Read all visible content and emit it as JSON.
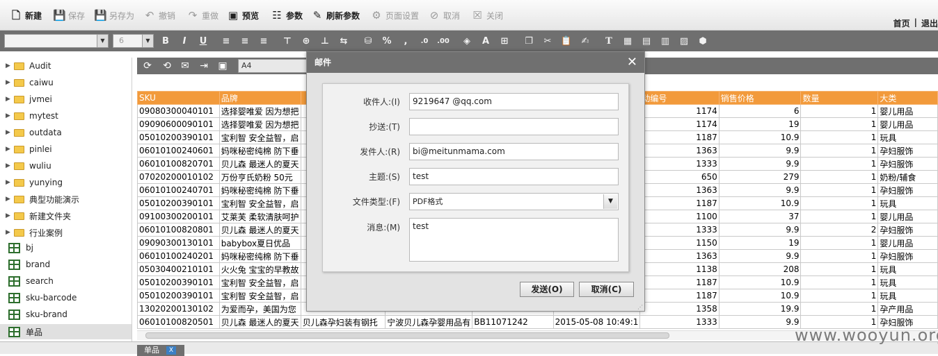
{
  "toolbar": {
    "new": "新建",
    "save": "保存",
    "save_as": "另存为",
    "undo": "撤销",
    "redo": "重做",
    "preview": "预览",
    "params": "参数",
    "refresh_params": "刷新参数",
    "page_setup": "页面设置",
    "cancel": "取消",
    "close": "关闭"
  },
  "top_nav": {
    "home": "首页",
    "logout": "退出"
  },
  "format_bar": {
    "font_size": "6"
  },
  "report_toolbar": {
    "zoom": "A4"
  },
  "sidebar": {
    "folders": [
      "Audit",
      "caiwu",
      "jvmei",
      "mytest",
      "outdata",
      "pinlei",
      "wuliu",
      "yunying",
      "典型功能演示",
      "新建文件夹",
      "行业案例"
    ],
    "reports": [
      "bj",
      "brand",
      "search",
      "sku-barcode",
      "sku-brand",
      "单品"
    ]
  },
  "table": {
    "headers": [
      "SKU",
      "品牌",
      "",
      "",
      "",
      "",
      "动编号",
      "销售价格",
      "数量",
      "大类"
    ],
    "rows": [
      [
        "09080300040101",
        "选择婴唯爱 因为想把",
        "",
        "",
        "",
        "",
        "1174",
        "6",
        "1",
        "婴儿用品"
      ],
      [
        "09090600090101",
        "选择婴唯爱 因为想把",
        "",
        "",
        "",
        "",
        "1174",
        "19",
        "1",
        "婴儿用品"
      ],
      [
        "05010200390101",
        "宝利智 安全益智，启",
        "",
        "",
        "",
        "",
        "1187",
        "10.9",
        "1",
        "玩具"
      ],
      [
        "06010100240601",
        "妈咪秘密纯棉 防下垂",
        "",
        "",
        "",
        "",
        "1363",
        "9.9",
        "1",
        "孕妇服饰"
      ],
      [
        "06010100820701",
        "贝儿森 最迷人的夏天",
        "",
        "",
        "",
        "",
        "1333",
        "9.9",
        "1",
        "孕妇服饰"
      ],
      [
        "07020200010102",
        "万份亨氏奶粉 50元",
        "",
        "",
        "",
        "",
        "650",
        "279",
        "1",
        "奶粉/辅食"
      ],
      [
        "06010100240701",
        "妈咪秘密纯棉 防下垂",
        "",
        "",
        "",
        "",
        "1363",
        "9.9",
        "1",
        "孕妇服饰"
      ],
      [
        "05010200390101",
        "宝利智 安全益智，启",
        "",
        "",
        "",
        "",
        "1187",
        "10.9",
        "1",
        "玩具"
      ],
      [
        "09100300200101",
        "艾莱芙 柔软清肤呵护",
        "",
        "",
        "",
        "",
        "1100",
        "37",
        "1",
        "婴儿用品"
      ],
      [
        "06010100820801",
        "贝儿森 最迷人的夏天",
        "",
        "",
        "",
        "",
        "1333",
        "9.9",
        "2",
        "孕妇服饰"
      ],
      [
        "09090300130101",
        "babybox夏日优品",
        "",
        "",
        "",
        "",
        "1150",
        "19",
        "1",
        "婴儿用品"
      ],
      [
        "06010100240201",
        "妈咪秘密纯棉 防下垂",
        "",
        "",
        "",
        "",
        "1363",
        "9.9",
        "1",
        "孕妇服饰"
      ],
      [
        "05030400210101",
        "火火兔 宝宝的早教故",
        "",
        "",
        "",
        "",
        "1138",
        "208",
        "1",
        "玩具"
      ],
      [
        "05010200390101",
        "宝利智 安全益智，启",
        "",
        "",
        "",
        "",
        "1187",
        "10.9",
        "1",
        "玩具"
      ],
      [
        "05010200390101",
        "宝利智 安全益智，启",
        "",
        "",
        "",
        "",
        "1187",
        "10.9",
        "1",
        "玩具"
      ],
      [
        "13020200130102",
        "为爱而孕，美国为您",
        "",
        "",
        "",
        "",
        "1358",
        "19.9",
        "1",
        "孕产用品"
      ],
      [
        "06010100820501",
        "贝儿森 最迷人的夏天",
        "贝儿森孕妇装有钢托",
        "宁波贝儿森孕婴用品有",
        "BB11071242",
        "2015-05-08 10:49:1",
        "1333",
        "9.9",
        "1",
        "孕妇服饰"
      ]
    ]
  },
  "tab": {
    "label": "单品"
  },
  "watermark": "www.wooyun.org",
  "dialog": {
    "title": "邮件",
    "fields": {
      "to_label": "收件人:(I)",
      "to_value": "9219647 @qq.com",
      "cc_label": "抄送:(T)",
      "cc_value": "",
      "from_label": "发件人:(R)",
      "from_value": "bi@meitunmama.com",
      "subject_label": "主题:(S)",
      "subject_value": "test",
      "filetype_label": "文件类型:(F)",
      "filetype_value": "PDF格式",
      "message_label": "消息:(M)",
      "message_value": "test"
    },
    "send": "发送(O)",
    "cancel": "取消(C)"
  }
}
